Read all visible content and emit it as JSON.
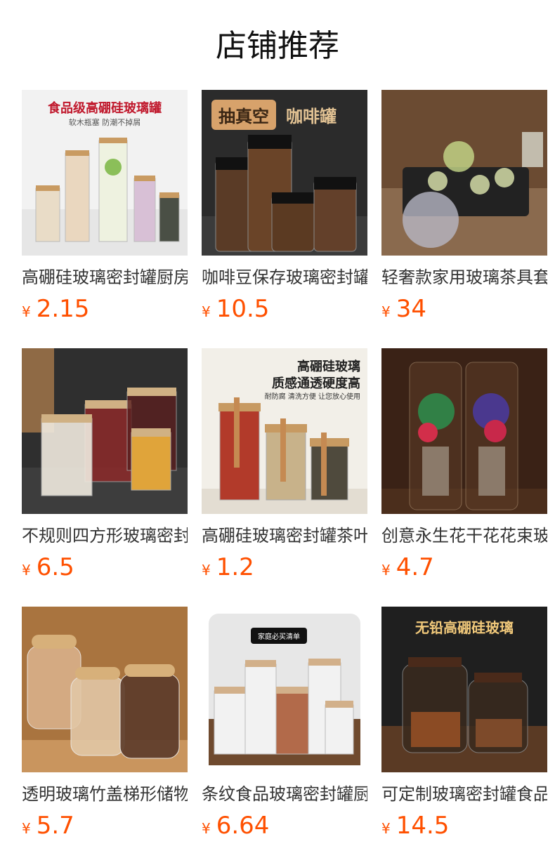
{
  "page_title": "店铺推荐",
  "colors": {
    "price": "#ff5000",
    "title": "#111111",
    "name": "#333333"
  },
  "products": [
    {
      "name": "高硼硅玻璃密封罐厨房",
      "currency_symbol": "¥",
      "price": "2.15",
      "image_text_1": "食品级高硼硅玻璃罐",
      "image_text_2": "软木瓶塞  防潮不掉屑"
    },
    {
      "name": "咖啡豆保存玻璃密封罐",
      "currency_symbol": "¥",
      "price": "10.5",
      "image_text_1": "抽真空",
      "image_text_2": "咖啡罐"
    },
    {
      "name": "轻奢款家用玻璃茶具套装",
      "currency_symbol": "¥",
      "price": "34"
    },
    {
      "name": "不规则四方形玻璃密封罐",
      "currency_symbol": "¥",
      "price": "6.5"
    },
    {
      "name": "高硼硅玻璃密封罐茶叶",
      "currency_symbol": "¥",
      "price": "1.2",
      "image_text_1": "高硼硅玻璃",
      "image_text_2": "质感通透硬度高",
      "image_text_3": "耐防腐 清洗方便 让您放心使用"
    },
    {
      "name": "创意永生花干花花束玻璃",
      "currency_symbol": "¥",
      "price": "4.7"
    },
    {
      "name": "透明玻璃竹盖梯形储物罐",
      "currency_symbol": "¥",
      "price": "5.7"
    },
    {
      "name": "条纹食品玻璃密封罐厨房",
      "currency_symbol": "¥",
      "price": "6.64",
      "image_text_1": "家庭必买清单"
    },
    {
      "name": "可定制玻璃密封罐食品级",
      "currency_symbol": "¥",
      "price": "14.5",
      "image_text_1": "无铅高硼硅玻璃"
    }
  ]
}
